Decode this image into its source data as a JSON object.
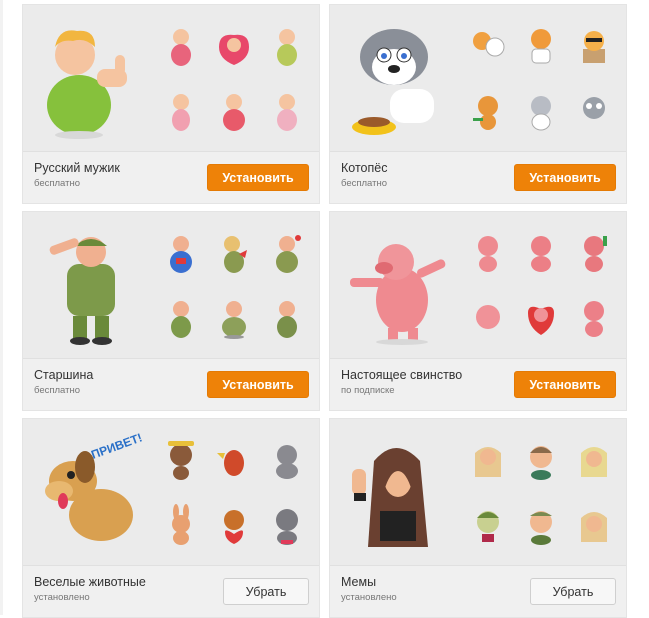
{
  "packs": [
    {
      "id": "russkiy-muzhik",
      "title": "Русский мужик",
      "status": "бесплатно",
      "button": "Установить",
      "button_type": "install",
      "hero_color": "#86c13c",
      "thumb_colors": [
        "#e8647c",
        "#e8486a",
        "#b7c95a",
        "#f1a0b0",
        "#e85a6a",
        "#f0b0c0"
      ]
    },
    {
      "id": "kotopes",
      "title": "Котопёс",
      "status": "бесплатно",
      "button": "Установить",
      "button_type": "install",
      "hero_color": "#8a8f98",
      "thumb_colors": [
        "#f0a040",
        "#f09a3a",
        "#f5b04a",
        "#e8963a",
        "#b8bcc4",
        "#9aa0a8"
      ]
    },
    {
      "id": "starshina",
      "title": "Старшина",
      "status": "бесплатно",
      "button": "Установить",
      "button_type": "install",
      "hero_color": "#7d9a4a",
      "thumb_colors": [
        "#3a6fd0",
        "#e8c070",
        "#8a9a50",
        "#7d9a4a",
        "#8da05a",
        "#7a904a"
      ]
    },
    {
      "id": "svinstvo",
      "title": "Настоящее свинство",
      "status": "по подписке",
      "button": "Установить",
      "button_type": "install",
      "hero_color": "#ef8a90",
      "thumb_colors": [
        "#ee8a90",
        "#ec7f86",
        "#e8787e",
        "#f09298",
        "#e03a3a",
        "#ec8088"
      ]
    },
    {
      "id": "veselye-zhivotnye",
      "title": "Веселые животные",
      "status": "установлено",
      "button": "Убрать",
      "button_type": "remove",
      "hero_color": "#d9a050",
      "hero_text": "ПРИВЕТ!",
      "thumb_colors": [
        "#8a5a3a",
        "#d04a2a",
        "#8a8a90",
        "#e8a070",
        "#c8702a",
        "#7a7a80"
      ]
    },
    {
      "id": "memy",
      "title": "Мемы",
      "status": "установлено",
      "button": "Убрать",
      "button_type": "remove",
      "hero_color": "#6a4030",
      "thumb_colors": [
        "#e8c890",
        "#8a6a4a",
        "#e8d890",
        "#c8d090",
        "#7a8a50",
        "#e8c890"
      ]
    }
  ]
}
